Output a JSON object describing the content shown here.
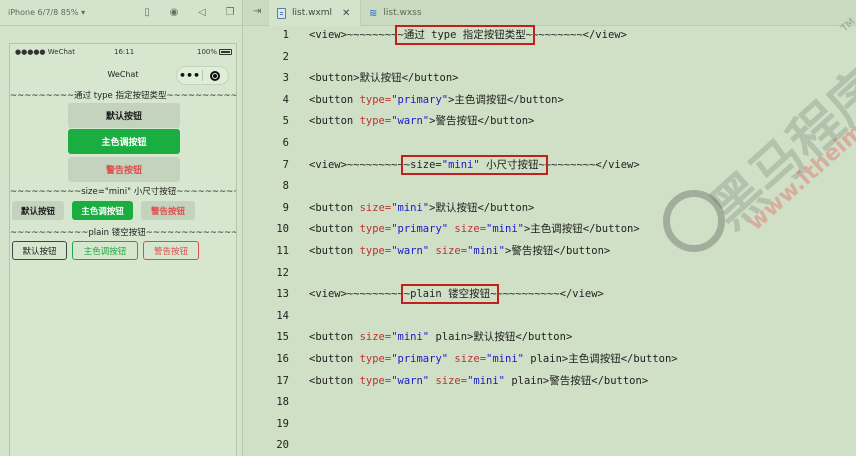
{
  "simulator": {
    "device_select": "iPhone 6/7/8 85% ▾",
    "toolbar_icons": [
      "phone-icon",
      "record-icon",
      "volume-icon",
      "window-icon"
    ],
    "status_bar": {
      "carrier": "●●●●● WeChat",
      "time": "16:11",
      "battery": "100%"
    },
    "nav_title": "WeChat",
    "capsule_more": "•••",
    "page": {
      "section1_title": "~~~~~~~~~通过 type 指定按钮类型~~~~~~~~~~~~~~~",
      "btn_default": "默认按钮",
      "btn_primary": "主色调按钮",
      "btn_warn": "警告按钮",
      "section2_title": "~~~~~~~~~~size=\"mini\" 小尺寸按钮~~~~~~~~~~~~",
      "mini_default": "默认按钮",
      "mini_primary": "主色调按钮",
      "mini_warn": "警告按钮",
      "section3_title": "~~~~~~~~~~~plain 镂空按钮~~~~~~~~~~~~~~~~",
      "plain_default": "默认按钮",
      "plain_primary": "主色调按钮",
      "plain_warn": "警告按钮"
    }
  },
  "editor": {
    "tabs": [
      {
        "label": "list.wxml",
        "close": "✕",
        "active": true
      },
      {
        "label": "list.wxss",
        "active": false
      }
    ],
    "lines": [
      {
        "num": "1",
        "parts": [
          [
            "<view>~~~~~~~~",
            ""
          ],
          [
            "~通过 type 指定按钮类型~",
            ""
          ],
          [
            "~~~~~~~~</view>",
            ""
          ]
        ]
      },
      {
        "num": "2",
        "parts": []
      },
      {
        "num": "3",
        "parts": [
          [
            "<button>默认按钮</button>",
            ""
          ]
        ]
      },
      {
        "num": "4",
        "parts": [
          [
            "<button ",
            ""
          ],
          [
            "type=",
            "attr"
          ],
          [
            "\"primary\"",
            "str"
          ],
          [
            ">主色调按钮</button>",
            ""
          ]
        ]
      },
      {
        "num": "5",
        "parts": [
          [
            "<button ",
            ""
          ],
          [
            "type=",
            "attr"
          ],
          [
            "\"warn\"",
            "str"
          ],
          [
            ">警告按钮</button>",
            ""
          ]
        ]
      },
      {
        "num": "6",
        "parts": []
      },
      {
        "num": "7",
        "parts": [
          [
            "<view>~~~~~~~~~",
            ""
          ],
          [
            "~size=",
            ""
          ],
          [
            "\"mini\"",
            "str"
          ],
          [
            " 小尺寸按钮~",
            ""
          ],
          [
            "~~~~~~~~</view>",
            ""
          ]
        ]
      },
      {
        "num": "8",
        "parts": []
      },
      {
        "num": "9",
        "parts": [
          [
            "<button ",
            ""
          ],
          [
            "size=",
            "attr"
          ],
          [
            "\"mini\"",
            "str"
          ],
          [
            ">默认按钮</button>",
            ""
          ]
        ]
      },
      {
        "num": "10",
        "parts": [
          [
            "<button ",
            ""
          ],
          [
            "type=",
            "attr"
          ],
          [
            "\"primary\"",
            "str"
          ],
          [
            " ",
            ""
          ],
          [
            "size=",
            "attr"
          ],
          [
            "\"mini\"",
            "str"
          ],
          [
            ">主色调按钮</button>",
            ""
          ]
        ]
      },
      {
        "num": "11",
        "parts": [
          [
            "<button ",
            ""
          ],
          [
            "type=",
            "attr"
          ],
          [
            "\"warn\"",
            "str"
          ],
          [
            " ",
            ""
          ],
          [
            "size=",
            "attr"
          ],
          [
            "\"mini\"",
            "str"
          ],
          [
            ">警告按钮</button>",
            ""
          ]
        ]
      },
      {
        "num": "12",
        "parts": []
      },
      {
        "num": "13",
        "parts": [
          [
            "<view>~~~~~~~~~",
            ""
          ],
          [
            "~plain 镂空按钮~",
            ""
          ],
          [
            "~~~~~~~~~~</view>",
            ""
          ]
        ]
      },
      {
        "num": "14",
        "parts": []
      },
      {
        "num": "15",
        "parts": [
          [
            "<button ",
            ""
          ],
          [
            "size=",
            "attr"
          ],
          [
            "\"mini\"",
            "str"
          ],
          [
            " plain>默认按钮</button>",
            ""
          ]
        ]
      },
      {
        "num": "16",
        "parts": [
          [
            "<button ",
            ""
          ],
          [
            "type=",
            "attr"
          ],
          [
            "\"primary\"",
            "str"
          ],
          [
            " ",
            ""
          ],
          [
            "size=",
            "attr"
          ],
          [
            "\"mini\"",
            "str"
          ],
          [
            " plain>主色调按钮</button>",
            ""
          ]
        ]
      },
      {
        "num": "17",
        "parts": [
          [
            "<button ",
            ""
          ],
          [
            "type=",
            "attr"
          ],
          [
            "\"warn\"",
            "str"
          ],
          [
            " ",
            ""
          ],
          [
            "size=",
            "attr"
          ],
          [
            "\"mini\"",
            "str"
          ],
          [
            " plain>警告按钮</button>",
            ""
          ]
        ]
      },
      {
        "num": "18",
        "parts": []
      },
      {
        "num": "19",
        "parts": []
      },
      {
        "num": "20",
        "parts": []
      }
    ]
  },
  "watermark": {
    "text": "黑马程序员",
    "url": "www.itheima.com",
    "tm": "TM"
  },
  "colors": {
    "primary": "#1aad40",
    "warn": "#e14b4b",
    "highlight_box": "#c31f1f",
    "attr": "#c03030",
    "string": "#1919c8"
  }
}
